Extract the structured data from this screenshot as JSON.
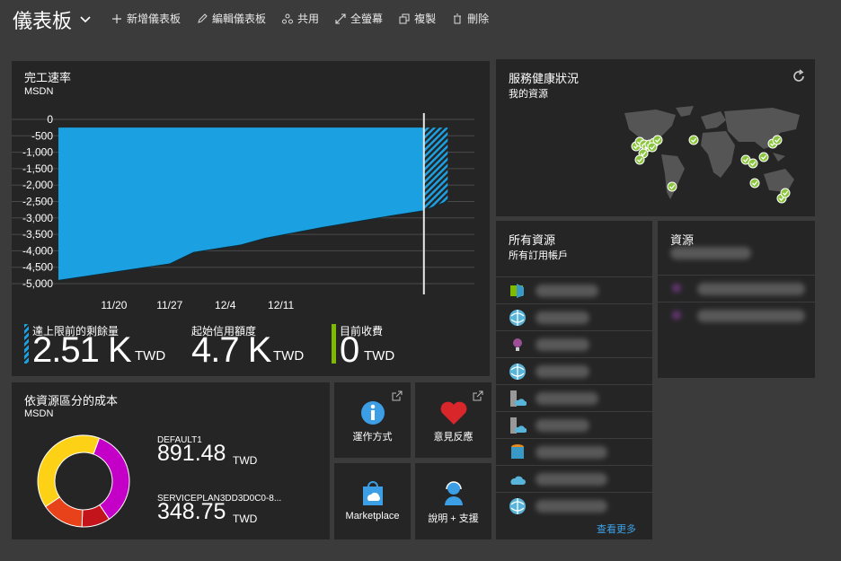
{
  "header": {
    "title": "儀表板",
    "actions": [
      "新增儀表板",
      "編輯儀表板",
      "共用",
      "全螢幕",
      "複製",
      "刪除"
    ]
  },
  "burn": {
    "title": "完工速率",
    "subtitle": "MSDN",
    "kpis": [
      {
        "label": "達上限前的剩餘量",
        "value": "2.51 K",
        "unit": "TWD"
      },
      {
        "label": "起始信用額度",
        "value": "4.7 K",
        "unit": "TWD"
      },
      {
        "label": "目前收費",
        "value": "0",
        "unit": "TWD"
      }
    ],
    "kpi_colors": [
      "#1ba1e2",
      "#1ba1e2",
      "#7fba00"
    ]
  },
  "chart_data": {
    "type": "area",
    "x": [
      "11/20",
      "11/27",
      "12/4",
      "12/11"
    ],
    "yticks": [
      "0",
      "-500",
      "-1,000",
      "-1,500",
      "-2,000",
      "-2,500",
      "-3,000",
      "-3,500",
      "-4,000",
      "-4,500",
      "-5,000"
    ],
    "ylim": [
      -5000,
      0
    ],
    "series": [
      {
        "values_x_days": [
          0,
          14,
          17,
          23,
          26,
          33,
          42,
          46,
          49
        ],
        "values": [
          -4900,
          -4400,
          -4050,
          -3820,
          -3620,
          -3300,
          -2930,
          -2780,
          -2490
        ]
      }
    ],
    "today_day": 46,
    "tick_days": [
      7,
      14,
      21,
      28
    ],
    "colors": {
      "fill": "#1ba1e2",
      "projection": "#1ba1e2"
    }
  },
  "health": {
    "title": "服務健康狀況",
    "subtitle": "我的資源"
  },
  "all_resources": {
    "title": "所有資源",
    "subtitle": "所有訂用帳戶",
    "more": "查看更多",
    "icons": [
      "app-service-icon",
      "globe-icon",
      "lightbulb-icon",
      "globe-icon",
      "server-cloud-icon",
      "server-cloud-icon",
      "mysql-db-icon",
      "cloud-icon",
      "globe-icon"
    ]
  },
  "resources": {
    "title": "資源"
  },
  "cost": {
    "title": "依資源區分的成本",
    "subtitle": "MSDN",
    "items": [
      {
        "name": "DEFAULT1",
        "value": "891.48",
        "unit": "TWD"
      },
      {
        "name": "SERVICEPLAN3DD3D0C0-8...",
        "value": "348.75",
        "unit": "TWD"
      }
    ],
    "donut": [
      {
        "value": 35,
        "color": "#c400c8"
      },
      {
        "value": 10,
        "color": "#c4141b"
      },
      {
        "value": 15,
        "color": "#e8421a"
      },
      {
        "value": 40,
        "color": "#fcd116"
      }
    ]
  },
  "links": [
    {
      "label": "運作方式",
      "icon": "info-icon"
    },
    {
      "label": "意見反應",
      "icon": "heart-icon"
    },
    {
      "label": "Marketplace",
      "icon": "marketplace-bag-icon"
    },
    {
      "label": "說明 + 支援",
      "icon": "support-person-icon"
    }
  ]
}
